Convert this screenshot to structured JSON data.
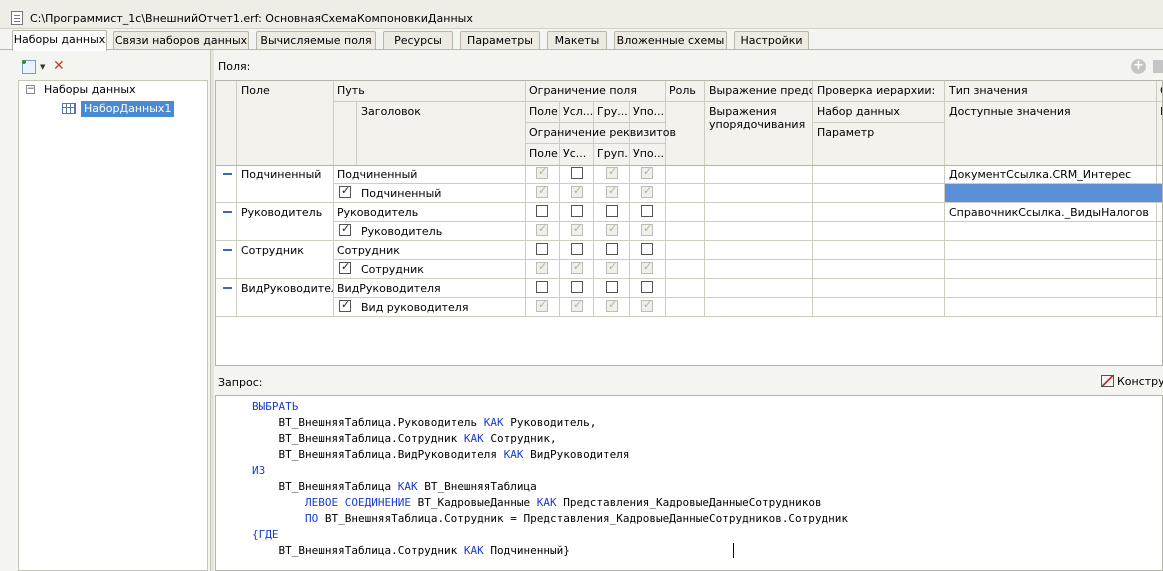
{
  "window": {
    "title": "C:\\Программист_1с\\ВнешнийОтчет1.erf: ОсновнаяСхемаКомпоновкиДанных"
  },
  "tabs": [
    {
      "label": "Наборы данных"
    },
    {
      "label": "Связи наборов данных"
    },
    {
      "label": "Вычисляемые поля"
    },
    {
      "label": "Ресурсы"
    },
    {
      "label": "Параметры"
    },
    {
      "label": "Макеты"
    },
    {
      "label": "Вложенные схемы"
    },
    {
      "label": "Настройки"
    }
  ],
  "tree": {
    "root": "Наборы данных",
    "item": "НаборДанных1"
  },
  "fields_label": "Поля:",
  "grid": {
    "headers": {
      "field": "Поле",
      "path": "Путь",
      "title": "Заголовок",
      "field_restriction": "Ограничение поля",
      "field_sub": [
        "Поле",
        "Усл...",
        "Гру...",
        "Упо..."
      ],
      "attr_restriction": "Ограничение реквизитов",
      "attr_sub": [
        "Поле",
        "Ус...",
        "Груп...",
        "Упо..."
      ],
      "role": "Роль",
      "presentation_expr": "Выражение предс...",
      "order_expr": "Выражения упорядочивания",
      "hierarchy_check": "Проверка иерархии:",
      "dataset": "Набор данных",
      "parameter": "Параметр",
      "value_type": "Тип значения",
      "available_values": "Доступные значения",
      "extra_col": "С",
      "extra_col_sub": "Р"
    },
    "rows": [
      {
        "field": "Подчиненный",
        "path": "Подчиненный",
        "title": "Подчиненный",
        "title_checked": true,
        "field_checks": [
          true,
          false,
          true,
          true
        ],
        "field_enabled": [
          false,
          true,
          false,
          false
        ],
        "attr_checks": [
          true,
          true,
          true,
          true
        ],
        "value_type": "ДокументСсылка.CRM_Интерес",
        "selected_available": true
      },
      {
        "field": "Руководитель",
        "path": "Руководитель",
        "title": "Руководитель",
        "title_checked": true,
        "field_checks": [
          false,
          false,
          false,
          false
        ],
        "field_enabled": [
          true,
          true,
          true,
          true
        ],
        "attr_checks": [
          true,
          true,
          true,
          true
        ],
        "value_type": "СправочникСсылка._ВидыНалогов",
        "selected_available": false
      },
      {
        "field": "Сотрудник",
        "path": "Сотрудник",
        "title": "Сотрудник",
        "title_checked": true,
        "field_checks": [
          false,
          false,
          false,
          false
        ],
        "field_enabled": [
          true,
          true,
          true,
          true
        ],
        "attr_checks": [
          true,
          true,
          true,
          true
        ],
        "value_type": "",
        "selected_available": false
      },
      {
        "field": "ВидРуководител",
        "path": "ВидРуководителя",
        "title": "Вид руководителя",
        "title_checked": true,
        "field_checks": [
          false,
          false,
          false,
          false
        ],
        "field_enabled": [
          true,
          true,
          true,
          true
        ],
        "attr_checks": [
          true,
          true,
          true,
          true
        ],
        "value_type": "",
        "selected_available": false
      }
    ]
  },
  "query_label": "Запрос:",
  "constructor_label": "Конструктор",
  "query_lines": [
    [
      {
        "k": true,
        "t": "ВЫБРАТЬ"
      }
    ],
    [
      {
        "k": false,
        "t": "    ВТ_ВнешняяТаблица.Руководитель "
      },
      {
        "k": true,
        "t": "КАК"
      },
      {
        "k": false,
        "t": " Руководитель,"
      }
    ],
    [
      {
        "k": false,
        "t": "    ВТ_ВнешняяТаблица.Сотрудник "
      },
      {
        "k": true,
        "t": "КАК"
      },
      {
        "k": false,
        "t": " Сотрудник,"
      }
    ],
    [
      {
        "k": false,
        "t": "    ВТ_ВнешняяТаблица.ВидРуководителя "
      },
      {
        "k": true,
        "t": "КАК"
      },
      {
        "k": false,
        "t": " ВидРуководителя"
      }
    ],
    [
      {
        "k": true,
        "t": "ИЗ"
      }
    ],
    [
      {
        "k": false,
        "t": "    ВТ_ВнешняяТаблица "
      },
      {
        "k": true,
        "t": "КАК"
      },
      {
        "k": false,
        "t": " ВТ_ВнешняяТаблица"
      }
    ],
    [
      {
        "k": true,
        "t": "        ЛЕВОЕ СОЕДИНЕНИЕ"
      },
      {
        "k": false,
        "t": " ВТ_КадровыеДанные "
      },
      {
        "k": true,
        "t": "КАК"
      },
      {
        "k": false,
        "t": " Представления_КадровыеДанныеСотрудников"
      }
    ],
    [
      {
        "k": true,
        "t": "        ПО"
      },
      {
        "k": false,
        "t": " ВТ_ВнешняяТаблица.Сотрудник = Представления_КадровыеДанныеСотрудников.Сотрудник"
      }
    ],
    [
      {
        "k": true,
        "t": "{ГДЕ"
      }
    ],
    [
      {
        "k": false,
        "t": "    ВТ_ВнешняяТаблица.Сотрудник "
      },
      {
        "k": true,
        "t": "КАК"
      },
      {
        "k": false,
        "t": " Подчиненный}"
      }
    ]
  ]
}
